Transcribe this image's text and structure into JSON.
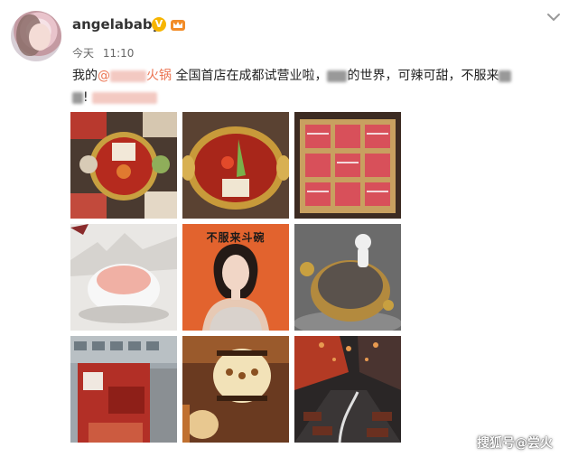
{
  "user": {
    "name": "angelababy",
    "verified_label": "V"
  },
  "meta": {
    "day": "今天",
    "time": "11:10"
  },
  "post": {
    "prefix": "我的",
    "link_text": "火锅",
    "body_1": "全国首店在成都试营业啦，",
    "body_2": "的世界，可辣可甜，不服来",
    "ending": "!"
  },
  "poster": {
    "title": "不服来斗碗"
  },
  "watermark": "搜狐号@尝火",
  "icons": [
    "chevron-down-icon",
    "crown-icon",
    "verified-badge-icon"
  ],
  "colors": {
    "link": "#eb7350",
    "verified": "#f7b500",
    "poster_bg": "#e2632e"
  }
}
